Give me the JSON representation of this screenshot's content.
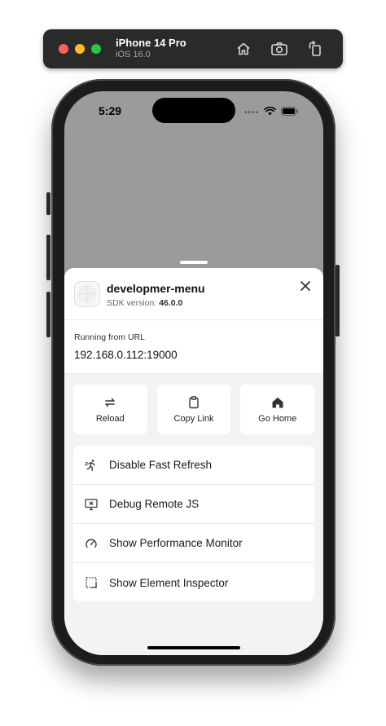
{
  "simulator": {
    "device_name": "iPhone 14 Pro",
    "os_version": "iOS 16.0",
    "toolbar_icons": [
      "home-icon",
      "screenshot-icon",
      "rotate-icon"
    ]
  },
  "status_bar": {
    "time": "5:29",
    "icons": [
      "signal-dots-icon",
      "wifi-icon",
      "battery-icon"
    ]
  },
  "dev_menu": {
    "app_name": "developmer-menu",
    "sdk_label": "SDK version:",
    "sdk_version": "46.0.0",
    "url_label": "Running from URL",
    "url_value": "192.168.0.112:19000",
    "actions": [
      {
        "label": "Reload",
        "icon": "reload-icon"
      },
      {
        "label": "Copy Link",
        "icon": "clipboard-icon"
      },
      {
        "label": "Go Home",
        "icon": "home-icon"
      }
    ],
    "items": [
      {
        "label": "Disable Fast Refresh",
        "icon": "runner-icon"
      },
      {
        "label": "Debug Remote JS",
        "icon": "monitor-debug-icon"
      },
      {
        "label": "Show Performance Monitor",
        "icon": "gauge-icon"
      },
      {
        "label": "Show Element Inspector",
        "icon": "inspector-icon"
      }
    ]
  },
  "colors": {
    "toolbar_bg": "#2b2a2a",
    "screen_backdrop": "#9b9b9b",
    "sheet_bg": "#f2f3f5"
  }
}
